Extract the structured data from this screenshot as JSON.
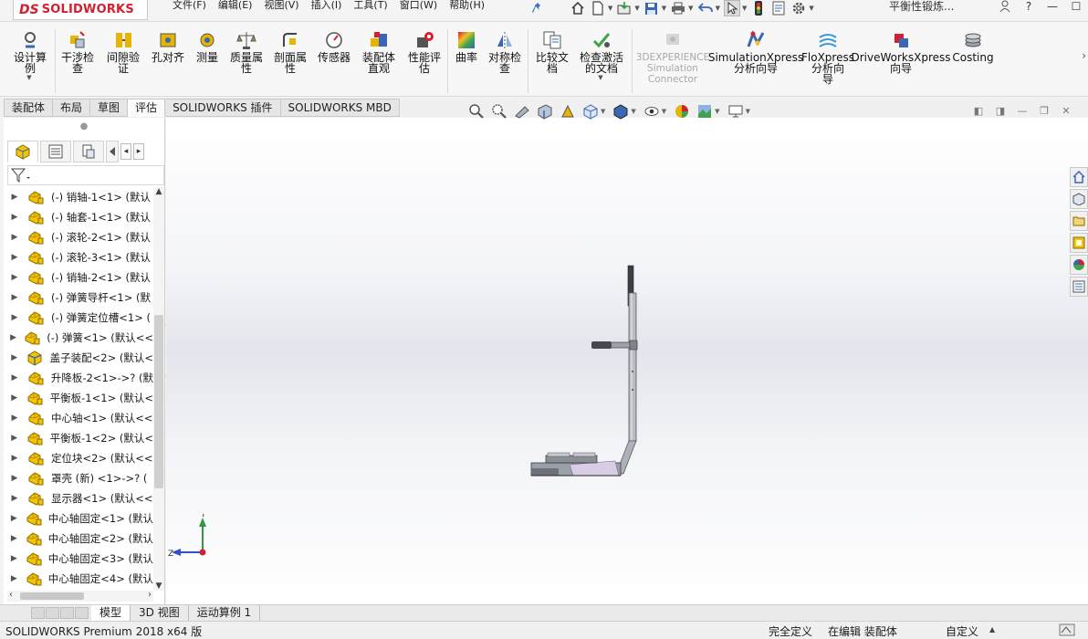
{
  "app": {
    "logo_ds": "DS",
    "logo_text": "SOLIDWORKS",
    "menus": [
      "文件(F)",
      "编辑(E)",
      "视图(V)",
      "插入(I)",
      "工具(T)",
      "窗口(W)",
      "帮助(H)"
    ],
    "doc_title": "平衡性锻炼...",
    "help_label": "?"
  },
  "commands": {
    "tools": [
      {
        "label": "设计算\n例",
        "icon": "design-study-icon"
      },
      {
        "label": "干涉检\n查",
        "icon": "interference-check-icon"
      },
      {
        "label": "间隙验\n证",
        "icon": "clearance-verification-icon"
      },
      {
        "label": "孔对齐",
        "icon": "hole-alignment-icon"
      },
      {
        "label": "测量",
        "icon": "measure-icon"
      },
      {
        "label": "质量属\n性",
        "icon": "mass-properties-icon"
      },
      {
        "label": "剖面属\n性",
        "icon": "section-properties-icon"
      },
      {
        "label": "传感器",
        "icon": "sensor-icon"
      },
      {
        "label": "装配体\n直观",
        "icon": "assembly-visualization-icon"
      },
      {
        "label": "性能评\n估",
        "icon": "performance-evaluation-icon"
      },
      {
        "label": "曲率",
        "icon": "curvature-icon"
      },
      {
        "label": "对称检\n查",
        "icon": "symmetry-check-icon"
      },
      {
        "label": "比较文\n档",
        "icon": "compare-documents-icon"
      },
      {
        "label": "检查激活\n的文档",
        "icon": "check-active-document-icon"
      },
      {
        "label": "3DEXPERIENCE\nSimulation\nConnector",
        "icon": "3dexperience-icon",
        "disabled": true
      },
      {
        "label": "SimulationXpress\n分析向导",
        "icon": "simulationxpress-icon"
      },
      {
        "label": "FloXpress\n分析向\n导",
        "icon": "floxpress-icon"
      },
      {
        "label": "DriveWorksXpress\n向导",
        "icon": "driveworksxpress-icon"
      },
      {
        "label": "Costing",
        "icon": "costing-icon"
      }
    ],
    "tabs": [
      "装配体",
      "布局",
      "草图",
      "评估",
      "SOLIDWORKS 插件",
      "SOLIDWORKS MBD"
    ],
    "active_tab": "评估"
  },
  "feature_tree": {
    "items": [
      "(-) 销轴-1<1> (默认",
      "(-) 轴套-1<1> (默认",
      "(-) 滚轮-2<1> (默认",
      "(-) 滚轮-3<1> (默认",
      "(-) 销轴-2<1> (默认",
      "(-) 弹簧导杆<1> (默",
      "(-) 弹簧定位槽<1> (",
      "(-) 弹簧<1> (默认<<",
      "盖子装配<2> (默认<",
      "升降板-2<1>->? (默",
      "平衡板-1<1> (默认<",
      "中心轴<1> (默认<<",
      "平衡板-1<2> (默认<",
      "定位块<2> (默认<<",
      "罩壳 (新) <1>->? (",
      "显示器<1> (默认<<",
      "中心轴固定<1> (默认",
      "中心轴固定<2> (默认",
      "中心轴固定<3> (默认",
      "中心轴固定<4> (默认"
    ],
    "subassembly_index": 8
  },
  "viewport": {
    "triad_y": "Y",
    "triad_z": "Z"
  },
  "model_tabs": [
    "模型",
    "3D 视图",
    "运动算例 1"
  ],
  "active_model_tab": "模型",
  "status": {
    "product": "SOLIDWORKS Premium 2018 x64 版",
    "definition": "完全定义",
    "editing": "在编辑 装配体",
    "units": "自定义"
  },
  "colors": {
    "brand_red": "#d2202f",
    "part_yellow": "#f5c400",
    "model_steel": "#8f949a"
  }
}
